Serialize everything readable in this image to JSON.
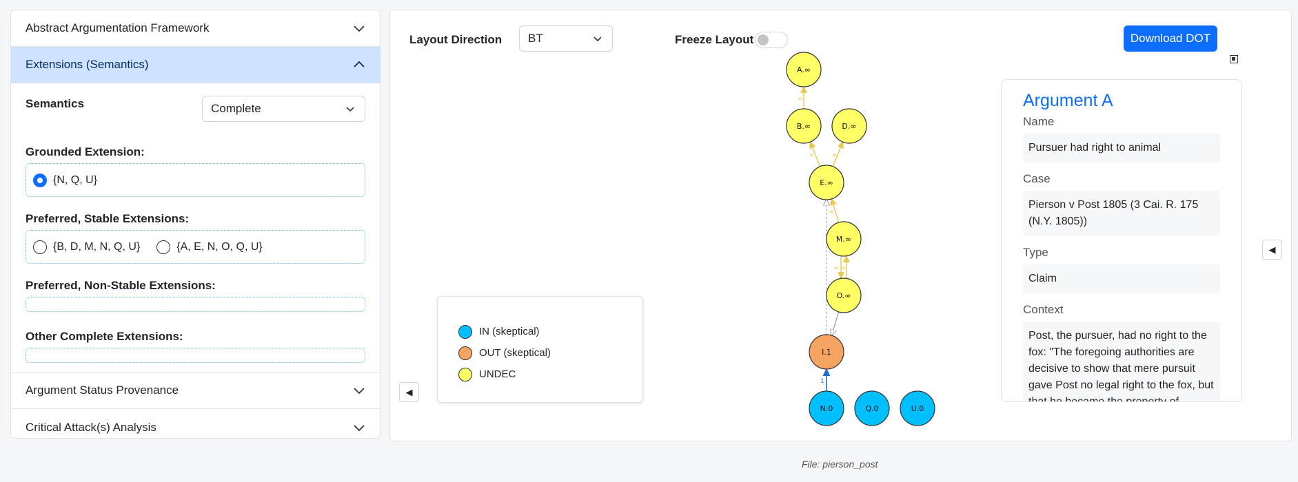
{
  "sidebar": {
    "sections": [
      {
        "title": "Abstract Argumentation Framework",
        "expanded": false
      },
      {
        "title": "Extensions (Semantics)",
        "expanded": true
      },
      {
        "title": "Argument Status Provenance",
        "expanded": false
      },
      {
        "title": "Critical Attack(s) Analysis",
        "expanded": false
      }
    ],
    "semantics_label": "Semantics",
    "semantics_value": "Complete",
    "grounded_label": "Grounded Extension:",
    "grounded_options": [
      "{N, Q, U}"
    ],
    "preferred_stable_label": "Preferred, Stable Extensions:",
    "preferred_stable_options": [
      "{B, D, M, N, Q, U}",
      "{A, E, N, O, Q, U}"
    ],
    "preferred_nonstable_label": "Preferred, Non-Stable Extensions:",
    "other_complete_label": "Other Complete Extensions:"
  },
  "toolbar": {
    "layout_direction_label": "Layout Direction",
    "layout_direction_value": "BT",
    "freeze_layout_label": "Freeze Layout",
    "download_label": "Download DOT"
  },
  "graph": {
    "colors": {
      "in": "#00bfff",
      "out": "#f4a460",
      "undec": "#ffff66"
    },
    "nodes": [
      {
        "id": "A",
        "label": "A.∞",
        "status": "undec"
      },
      {
        "id": "B",
        "label": "B.∞",
        "status": "undec"
      },
      {
        "id": "D",
        "label": "D.∞",
        "status": "undec"
      },
      {
        "id": "E",
        "label": "E.∞",
        "status": "undec"
      },
      {
        "id": "M",
        "label": "M.∞",
        "status": "undec"
      },
      {
        "id": "O",
        "label": "O.∞",
        "status": "undec"
      },
      {
        "id": "I",
        "label": "I.1",
        "status": "out"
      },
      {
        "id": "N",
        "label": "N.0",
        "status": "in"
      },
      {
        "id": "Q",
        "label": "Q.0",
        "status": "in"
      },
      {
        "id": "U",
        "label": "U.0",
        "status": "in"
      }
    ],
    "edge_label_undec": "∞",
    "edge_label_NI": "1"
  },
  "legend": {
    "items": [
      {
        "label": "IN (skeptical)",
        "color": "#00bfff"
      },
      {
        "label": "OUT (skeptical)",
        "color": "#f4a460"
      },
      {
        "label": "UNDEC",
        "color": "#ffff66"
      }
    ]
  },
  "argument": {
    "title": "Argument A",
    "name_label": "Name",
    "name_value": "Pursuer had right to animal",
    "case_label": "Case",
    "case_value": "Pierson v Post 1805 (3 Cai. R. 175 (N.Y. 1805))",
    "type_label": "Type",
    "type_value": "Claim",
    "context_label": "Context",
    "context_value": "Post, the pursuer, had no right to the fox: \"The foregoing authorities are decisive to show that mere pursuit gave Post no legal right to the fox, but that he became the property of Pierson, who intercepted and killed him.\""
  },
  "footer": {
    "file": "File: pierson_post"
  }
}
